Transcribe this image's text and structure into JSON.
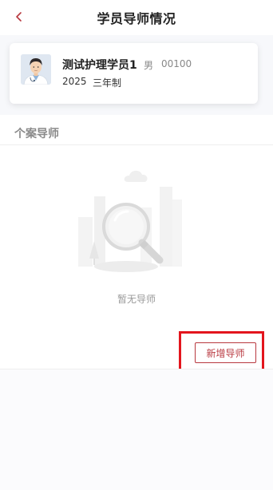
{
  "header": {
    "title": "学员导师情况",
    "back_icon": "chevron-left-icon",
    "accent": "#b8383f"
  },
  "student": {
    "avatar_icon": "doctor-avatar-icon",
    "name": "测试护理学员1",
    "gender": "男",
    "code": "00100",
    "year": "2025",
    "program": "三年制"
  },
  "section": {
    "title": "个案导师"
  },
  "empty_state": {
    "illustration_icon": "empty-search-illustration",
    "text": "暂无导师"
  },
  "actions": {
    "add_tutor_label": "新增导师"
  }
}
